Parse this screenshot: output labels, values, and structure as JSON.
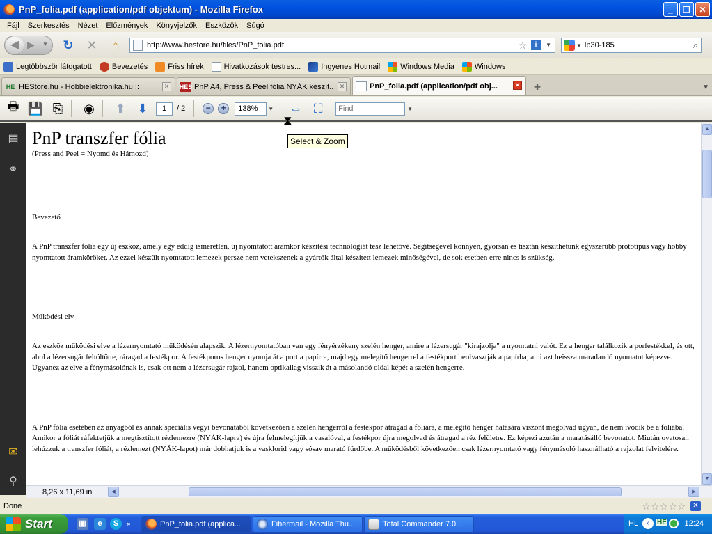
{
  "window": {
    "title": "PnP_folia.pdf (application/pdf objektum) - Mozilla Firefox"
  },
  "menu": [
    "Fájl",
    "Szerkesztés",
    "Nézet",
    "Előzmények",
    "Könyvjelzők",
    "Eszközök",
    "Súgó"
  ],
  "nav": {
    "url": "http://www.hestore.hu/files/PnP_folia.pdf",
    "search_value": "lp30-185"
  },
  "bookmarks": [
    {
      "label": "Legtöbbször látogatott",
      "icon": "bookmark-folder-icon"
    },
    {
      "label": "Bevezetés",
      "icon": "firefox-bug-icon"
    },
    {
      "label": "Friss hírek",
      "icon": "rss-feed-icon"
    },
    {
      "label": "Hivatkozások testres...",
      "icon": "page-icon"
    },
    {
      "label": "Ingyenes Hotmail",
      "icon": "msn-icon"
    },
    {
      "label": "Windows Media",
      "icon": "windows-logo-icon"
    },
    {
      "label": "Windows",
      "icon": "windows-logo-icon"
    }
  ],
  "tabs": [
    {
      "label": "HEStore.hu - Hobbielektronika.hu ::",
      "favicon": "HE",
      "active": false
    },
    {
      "label": "PnP A4, Press & Peel fólia NYÁK készít...",
      "favicon": "HES",
      "active": false
    },
    {
      "label": "PnP_folia.pdf (application/pdf obj...",
      "favicon": "",
      "active": true
    }
  ],
  "pdf_toolbar": {
    "page": "1",
    "page_total": "/ 2",
    "zoom": "138%",
    "find_placeholder": "Find"
  },
  "tooltip": "Select & Zoom",
  "document": {
    "title": "PnP transzfer fólia",
    "subtitle": "(Press and Peel = Nyomd és Hámozd)",
    "section1": "Bevezető",
    "para1": "A PnP transzfer fólia egy új eszköz, amely egy eddig ismeretlen, új nyomtatott áramkör készítési technológiát tesz lehetővé. Segítségével könnyen, gyorsan és tisztán készíthetünk egyszerűbb prototípus vagy hobby nyomtatott áramköröket. Az ezzel készült nyomtatott lemezek persze nem vetekszenek a gyártók által készített lemezek minőségével, de sok esetben erre nincs is szükség.",
    "section2": "Működési elv",
    "para2": "Az eszköz működési elve a lézernyomtató működésén alapszik. A lézernyomtatóban van egy fényérzékeny szelén henger, amire a lézersugár \"kirajzolja\" a nyomtatni valót. Ez a henger találkozik a porfestékkel, és ott, ahol a lézersugár feltöltötte, ráragad a festékpor. A festékporos henger nyomja át a port a papírra, majd egy melegítő hengerrel a festékport beolvasztják a papírba, ami azt beissza maradandó nyomatot képezve. Ugyanez az elve a fénymásolónak is, csak ott nem a lézersugár rajzol, hanem optikailag visszik át a másolandó oldal képét a szelén hengerre.",
    "para3": "A PnP fólia esetében az anyagból és annak speciális vegyi bevonatából következően a szelén hengerről a festékpor átragad a fóliára, a melegítő henger hatására viszont megolvad ugyan, de nem ivódik be a fóliába. Amikor a fóliát ráfektetjük a megtisztított rézlemezre (NYÁK-lapra) és újra felmelegítjük a vasalóval, a festékpor újra megolvad és átragad a réz felületre. Ez képezi azután a maratásálló bevonatot. Miután ovatosan lehúzzuk a transzfer fóliát, a rézlemezt (NYÁK-lapot) már dobhatjuk is a vasklorid vagy sósav marató fürdőbe. A működésből következően csak lézernyomtató vagy fénymásoló használható a rajzolat felvitelére."
  },
  "page_size": "8,26 x 11,69 in",
  "status": {
    "text": "Done"
  },
  "taskbar": {
    "start": "Start",
    "tasks": [
      "PnP_folia.pdf (applica...",
      "Fibermail - Mozilla Thu...",
      "Total Commander 7.0..."
    ],
    "lang": "HL",
    "clock": "12:24"
  }
}
